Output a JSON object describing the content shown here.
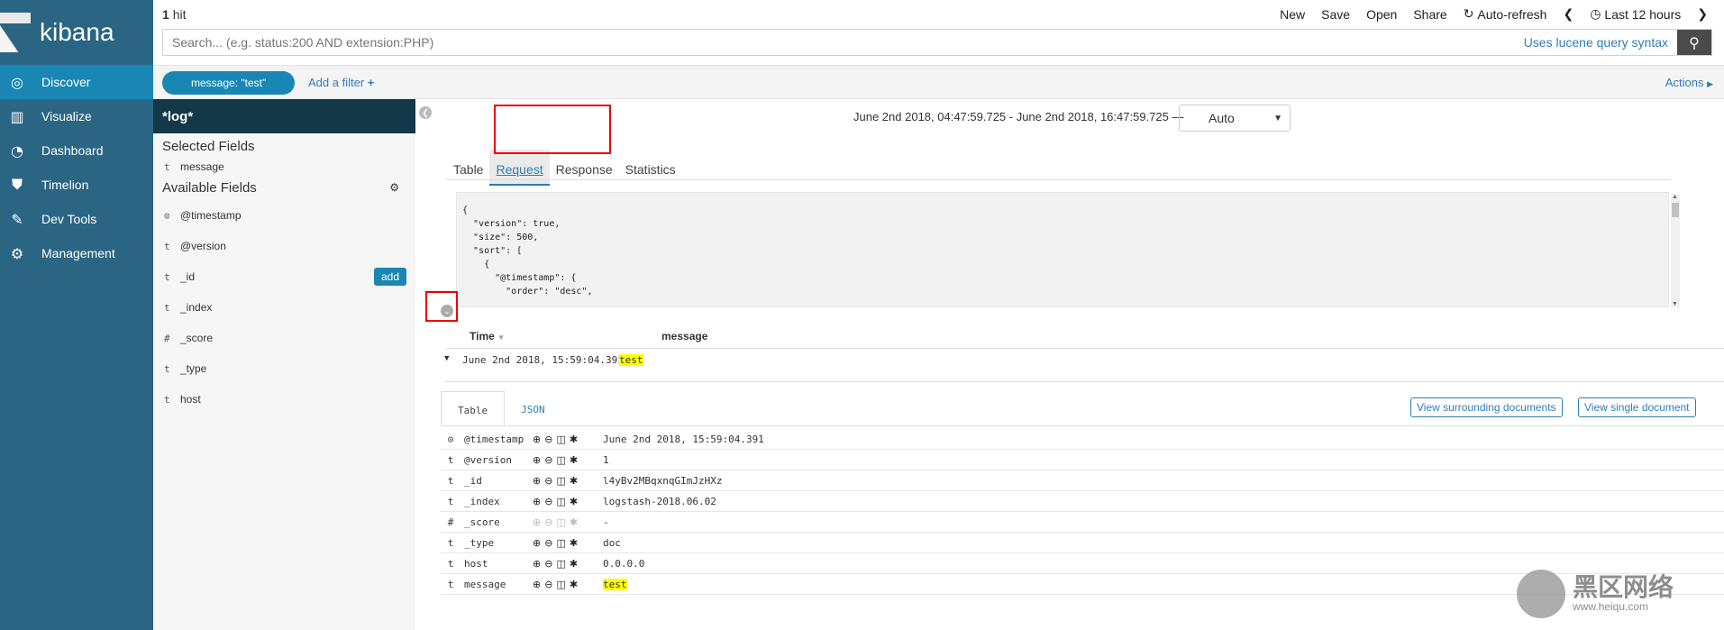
{
  "app": {
    "brand": "kibana"
  },
  "nav": {
    "items": [
      {
        "label": "Discover",
        "icon": "compass-icon",
        "glyph": "◎",
        "active": true
      },
      {
        "label": "Visualize",
        "icon": "bar-chart-icon",
        "glyph": "▥",
        "active": false
      },
      {
        "label": "Dashboard",
        "icon": "dashboard-icon",
        "glyph": "◔",
        "active": false
      },
      {
        "label": "Timelion",
        "icon": "shield-icon",
        "glyph": "⛊",
        "active": false
      },
      {
        "label": "Dev Tools",
        "icon": "wrench-icon",
        "glyph": "✎",
        "active": false
      },
      {
        "label": "Management",
        "icon": "gear-icon",
        "glyph": "⚙",
        "active": false
      }
    ]
  },
  "topbar": {
    "hits_count": "1",
    "hits_label": "hit",
    "menu": [
      "New",
      "Save",
      "Open",
      "Share"
    ],
    "auto_refresh": "Auto-refresh",
    "time_label": "Last 12 hours",
    "search_placeholder": "Search... (e.g. status:200 AND extension:PHP)",
    "lucene_link": "Uses lucene query syntax"
  },
  "filterbar": {
    "filter_pill": "message: \"test\"",
    "add_filter": "Add a filter",
    "actions": "Actions"
  },
  "sidebar": {
    "index_pattern": "*log*",
    "selected_title": "Selected Fields",
    "selected_fields": [
      {
        "type": "t",
        "name": "message"
      }
    ],
    "available_title": "Available Fields",
    "available_fields": [
      {
        "type": "⊙",
        "name": "@timestamp"
      },
      {
        "type": "t",
        "name": "@version"
      },
      {
        "type": "t",
        "name": "_id"
      },
      {
        "type": "t",
        "name": "_index"
      },
      {
        "type": "#",
        "name": "_score"
      },
      {
        "type": "t",
        "name": "_type"
      },
      {
        "type": "t",
        "name": "host"
      }
    ],
    "add_label": "add"
  },
  "inspector": {
    "time_range": "June 2nd 2018, 04:47:59.725 - June 2nd 2018, 16:47:59.725 —",
    "interval": "Auto",
    "tabs": [
      "Table",
      "Request",
      "Response",
      "Statistics"
    ],
    "active_tab": "Request",
    "request_code": "{\n  \"version\": true,\n  \"size\": 500,\n  \"sort\": [\n    {\n      \"@timestamp\": {\n        \"order\": \"desc\","
  },
  "results": {
    "columns": [
      "Time",
      "message"
    ],
    "row": {
      "time": "June 2nd 2018, 15:59:04.391",
      "message": "test"
    },
    "doc_tabs": [
      "Table",
      "JSON"
    ],
    "view_surrounding": "View surrounding documents",
    "view_single": "View single document",
    "doc_fields": [
      {
        "type": "⊙",
        "name": "@timestamp",
        "value": "June 2nd 2018, 15:59:04.391",
        "dim": false,
        "highlight": false
      },
      {
        "type": "t",
        "name": "@version",
        "value": "1",
        "dim": false,
        "highlight": false
      },
      {
        "type": "t",
        "name": "_id",
        "value": "l4yBv2MBqxnqGImJzHXz",
        "dim": false,
        "highlight": false
      },
      {
        "type": "t",
        "name": "_index",
        "value": "logstash-2018.06.02",
        "dim": false,
        "highlight": false
      },
      {
        "type": "#",
        "name": "_score",
        "value": " -",
        "dim": true,
        "highlight": false
      },
      {
        "type": "t",
        "name": "_type",
        "value": "doc",
        "dim": false,
        "highlight": false
      },
      {
        "type": "t",
        "name": "host",
        "value": "0.0.0.0",
        "dim": false,
        "highlight": false
      },
      {
        "type": "t",
        "name": "message",
        "value": "test",
        "dim": false,
        "highlight": true
      }
    ]
  },
  "watermark": {
    "text": "黑区网络",
    "url": "www.heiqu.com"
  }
}
